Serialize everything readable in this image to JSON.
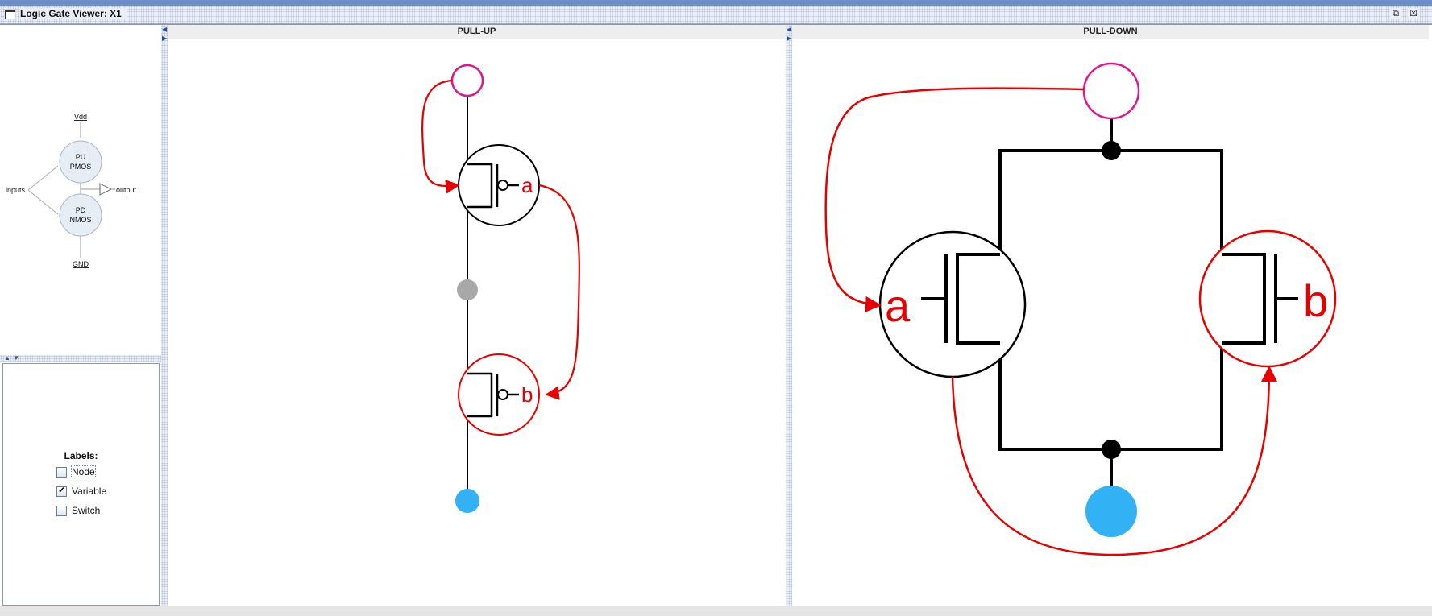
{
  "window": {
    "title": "Logic Gate Viewer: X1",
    "restore_glyph": "⧉",
    "close_glyph": "☒"
  },
  "legend": {
    "vdd": "Vdd",
    "pu_line1": "PU",
    "pu_line2": "PMOS",
    "pd_line1": "PD",
    "pd_line2": "NMOS",
    "inputs": "inputs",
    "output": "output",
    "gnd": "GND"
  },
  "options": {
    "title": "Labels:",
    "items": [
      {
        "label": "Node",
        "checked": false
      },
      {
        "label": "Variable",
        "checked": true
      },
      {
        "label": "Switch",
        "checked": false
      }
    ]
  },
  "pullup": {
    "header": "PULL-UP",
    "label_a": "a",
    "label_b": "b"
  },
  "pulldown": {
    "header": "PULL-DOWN",
    "label_a": "a",
    "label_b": "b"
  },
  "colors": {
    "wire": "#000000",
    "var_edge": "#e60000",
    "output_node": "#e0168f",
    "ground_node": "#33b1f5",
    "mid_node": "#a8a8a8"
  }
}
